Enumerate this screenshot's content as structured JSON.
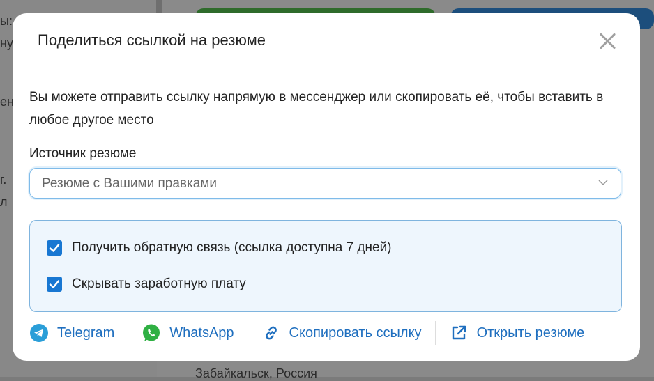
{
  "background": {
    "fragments": [
      "ы:",
      "ну",
      "ен",
      "г.",
      "л"
    ],
    "bottom_text": "Забайкальск, Россия"
  },
  "modal": {
    "title": "Поделиться ссылкой на резюме",
    "description": "Вы можете отправить ссылку напрямую в мессенджер или скопировать её, чтобы вставить в любое другое место",
    "source_label": "Источник резюме",
    "source_value": "Резюме с Вашими правками",
    "options": [
      {
        "label": "Получить обратную связь (ссылка доступна 7 дней)",
        "checked": true
      },
      {
        "label": "Скрывать заработную плату",
        "checked": true
      }
    ],
    "actions": [
      {
        "label": "Telegram",
        "icon": "telegram-icon"
      },
      {
        "label": "WhatsApp",
        "icon": "whatsapp-icon"
      },
      {
        "label": "Скопировать ссылку",
        "icon": "link-icon"
      },
      {
        "label": "Открыть резюме",
        "icon": "external-link-icon"
      }
    ]
  },
  "colors": {
    "accent": "#1877d2",
    "link": "#1f6fbf",
    "telegram": "#2a9ed8",
    "whatsapp": "#2fb043",
    "options_bg": "#eef6fd"
  }
}
